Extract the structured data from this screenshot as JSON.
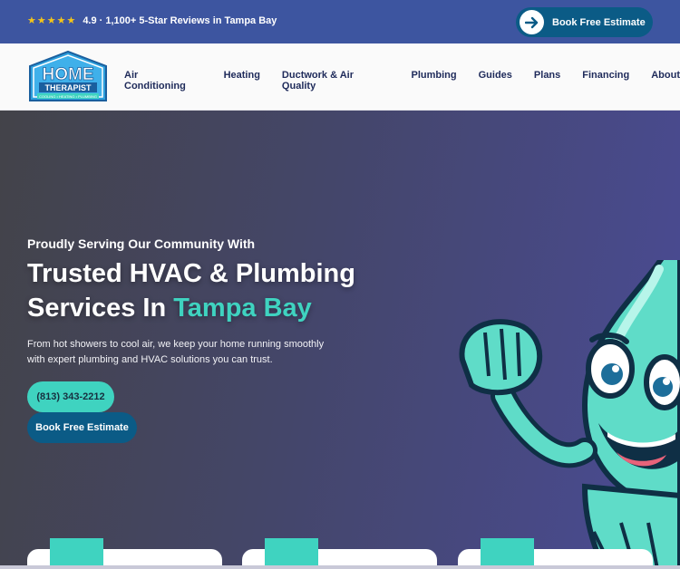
{
  "topbar": {
    "stars": "★★★★★",
    "rating_text": "4.9 · 1,100+ 5-Star Reviews in Tampa Bay",
    "cta_label": "Book Free Estimate"
  },
  "logo": {
    "line1": "HOME",
    "line2": "THERAPIST",
    "tagline": "COOLING • HEATING • PLUMBING"
  },
  "nav": {
    "items": [
      {
        "label": "Air Conditioning"
      },
      {
        "label": "Heating"
      },
      {
        "label": "Ductwork & Air Quality"
      },
      {
        "label": "Plumbing"
      },
      {
        "label": "Guides"
      },
      {
        "label": "Plans"
      },
      {
        "label": "Financing"
      },
      {
        "label": "About"
      }
    ]
  },
  "hero": {
    "eyebrow": "Proudly Serving Our Community With",
    "headline_line1": "Trusted HVAC & Plumbing",
    "headline_line2_plain": "Services In ",
    "headline_line2_accent": "Tampa Bay",
    "description": "From hot showers to cool air, we keep your home running smoothly with expert plumbing and HVAC solutions you can trust.",
    "phone_label": "(813) 343-2212",
    "book_label": "Book Free Estimate"
  },
  "colors": {
    "topbar": "#3d55a0",
    "accent": "#3fd3c0",
    "brand_dark": "#0b5b86",
    "nav_text": "#1e2a5a"
  },
  "icons": {
    "top_cta": "arrow-right-icon",
    "card_1": "hands-icon",
    "card_2": "gear-icon",
    "card_3": "shield-icon"
  }
}
